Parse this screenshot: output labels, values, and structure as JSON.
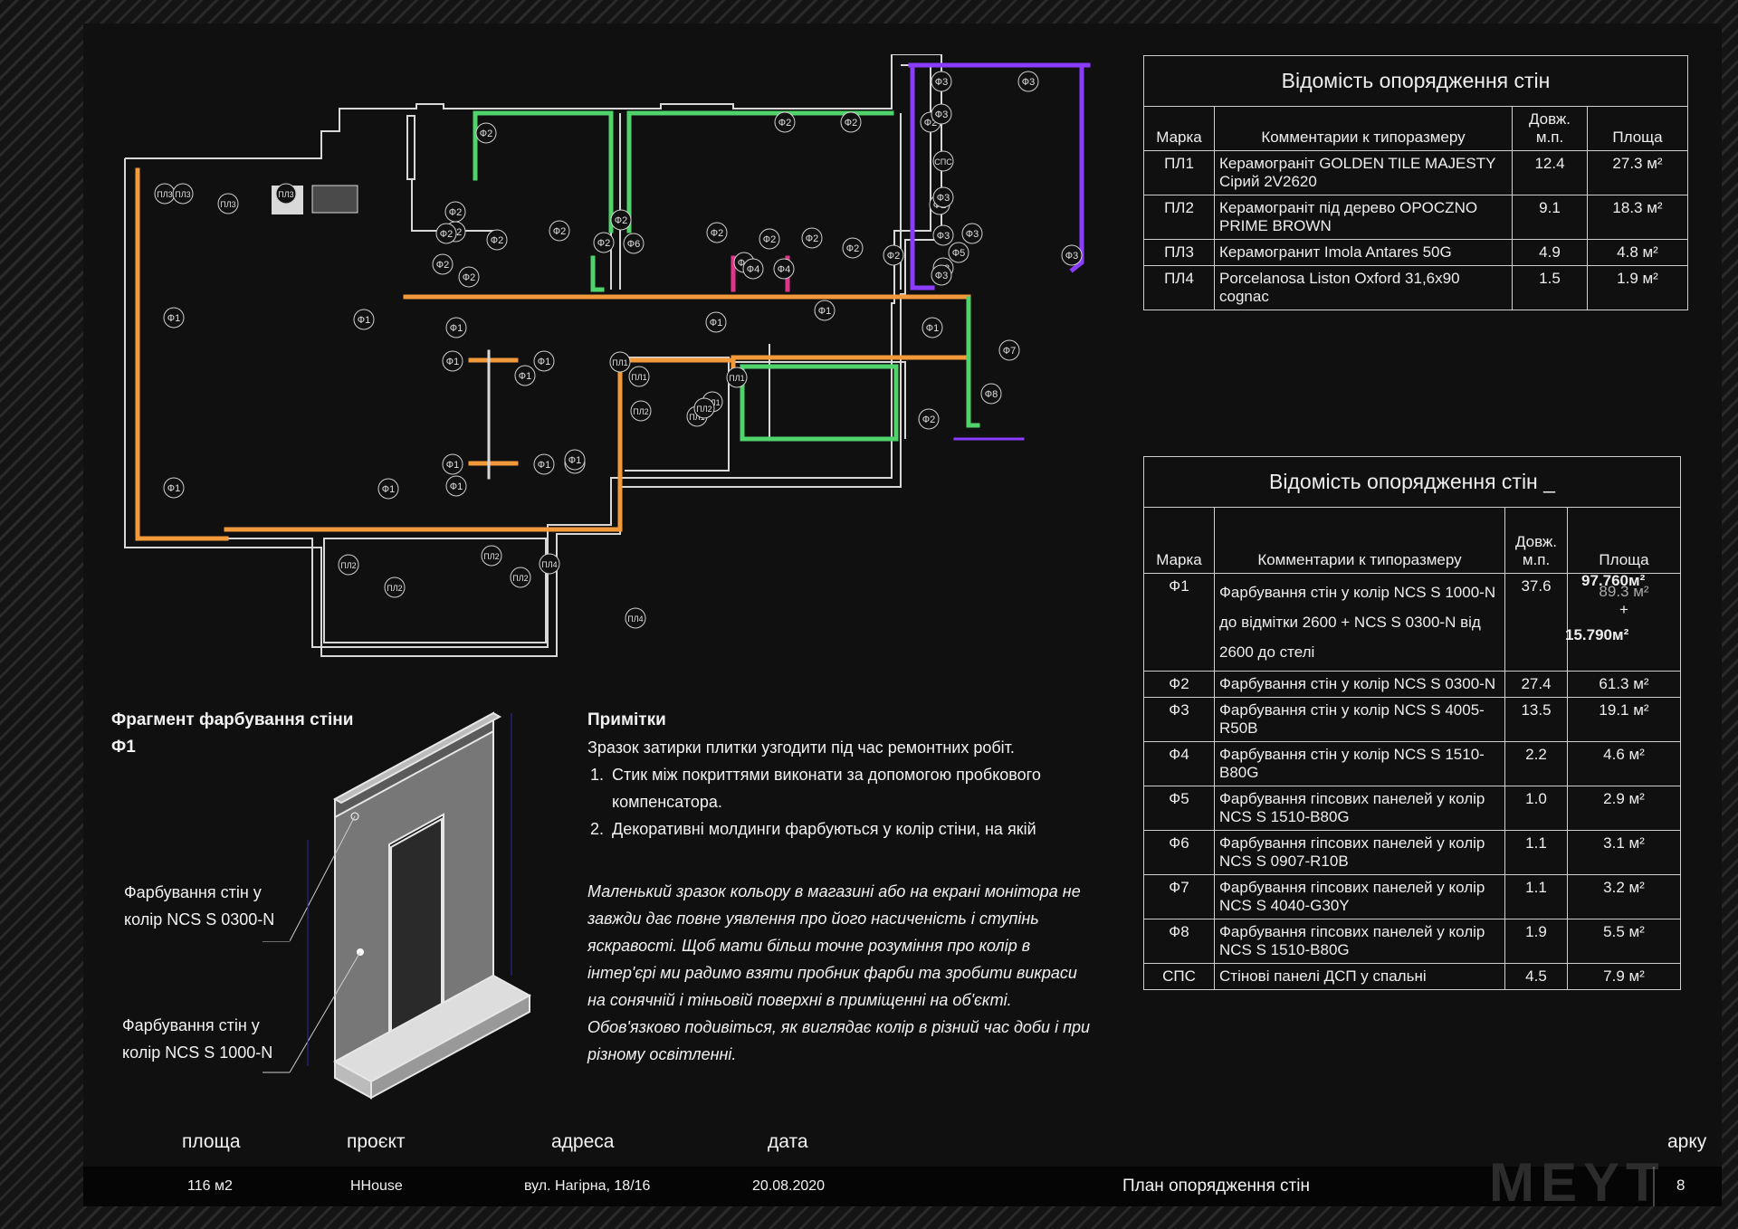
{
  "table1": {
    "title": "Відомість опорядження стін",
    "headers": [
      "Марка",
      "Комментарии к типоразмеру",
      "Довж. м.п.",
      "Площа"
    ],
    "rows": [
      {
        "mark": "ПЛ1",
        "comment": "Керамограніт GOLDEN TILE MAJESTY Сірий 2V2620",
        "length": "12.4",
        "area": "27.3 м²"
      },
      {
        "mark": "ПЛ2",
        "comment": "Керамограніт під дерево OPOCZNO PRIME BROWN",
        "length": "9.1",
        "area": "18.3 м²"
      },
      {
        "mark": "ПЛ3",
        "comment": "Керамогранит Imola Antares 50G",
        "length": "4.9",
        "area": "4.8 м²"
      },
      {
        "mark": "ПЛ4",
        "comment": "Porcelanosa Liston Oxford 31,6x90 cognac",
        "length": "1.5",
        "area": "1.9 м²"
      }
    ]
  },
  "table2": {
    "title": "Відомість опорядження стін _",
    "headers": [
      "Марка",
      "Комментарии к типоразмеру",
      "Довж. м.п.",
      "Площа"
    ],
    "rows": [
      {
        "mark": "Ф1",
        "comment": "Фарбування стін у колір NCS S 1000-N до відмітки 2600 + NCS S 0300-N від 2600 до стелі",
        "length": "37.6",
        "area": "89.3 м²",
        "area_extra_1": "97.760м²",
        "area_extra_plus": "+",
        "area_extra_2": "15.790м²"
      },
      {
        "mark": "Ф2",
        "comment": "Фарбування стін у колір NCS S 0300-N",
        "length": "27.4",
        "area": "61.3 м²"
      },
      {
        "mark": "Ф3",
        "comment": "Фарбування стін у колір NCS S 4005-R50B",
        "length": "13.5",
        "area": "19.1 м²"
      },
      {
        "mark": "Ф4",
        "comment": "Фарбування стін у колір NCS S 1510-B80G",
        "length": "2.2",
        "area": "4.6 м²"
      },
      {
        "mark": "Ф5",
        "comment": "Фарбування гіпсових панелей у колір NCS S 1510-B80G",
        "length": "1.0",
        "area": "2.9 м²"
      },
      {
        "mark": "Ф6",
        "comment": "Фарбування гіпсових панелей у колір NCS S 0907-R10B",
        "length": "1.1",
        "area": "3.1 м²"
      },
      {
        "mark": "Ф7",
        "comment": "Фарбування гіпсових панелей у колір NCS S 4040-G30Y",
        "length": "1.1",
        "area": "3.2 м²"
      },
      {
        "mark": "Ф8",
        "comment": "Фарбування гіпсових панелей у колір NCS S 1510-B80G",
        "length": "1.9",
        "area": "5.5 м²"
      },
      {
        "mark": "СПС",
        "comment": "Стінові панелі ДСП у спальні",
        "length": "4.5",
        "area": "7.9 м²"
      }
    ]
  },
  "plan": {
    "tags": [
      "ПЛ3",
      "ПЛ3",
      "ПЛ3",
      "ПЛ3",
      "Ф1",
      "Ф1",
      "Ф1",
      "Ф1",
      "Ф1",
      "Ф1",
      "Ф1",
      "Ф1",
      "Ф1",
      "Ф1",
      "Ф1",
      "Ф1",
      "Ф1",
      "Ф1",
      "Ф1",
      "Ф1",
      "Ф2",
      "Ф2",
      "Ф2",
      "Ф2",
      "Ф2",
      "Ф2",
      "Ф2",
      "Ф2",
      "Ф2",
      "Ф2",
      "Ф2",
      "Ф2",
      "Ф2",
      "Ф2",
      "Ф2",
      "Ф2",
      "Ф2",
      "Ф2",
      "Ф2",
      "Ф2",
      "Ф3",
      "Ф3",
      "Ф3",
      "Ф3",
      "Ф3",
      "Ф3",
      "Ф3",
      "Ф3",
      "Ф3",
      "Ф3",
      "Ф3",
      "Ф3",
      "СПС",
      "Ф4",
      "Ф4",
      "Ф4",
      "Ф5",
      "Ф6",
      "Ф7",
      "Ф8",
      "ПЛ1",
      "ПЛ1",
      "ПЛ1",
      "ПЛ1",
      "ПЛ1",
      "ПЛ2",
      "ПЛ2",
      "ПЛ2",
      "ПЛ2",
      "ПЛ2",
      "ПЛ2",
      "ПЛ4",
      "ПЛ4"
    ],
    "colors": {
      "orange": "#f29a3a",
      "green": "#4fd36a",
      "purple": "#8a3cff",
      "pink": "#e0368a",
      "wall": "#d8d8d8"
    }
  },
  "fragment": {
    "title_line1": "Фрагмент фарбування стіни",
    "title_line2": "Ф1",
    "label1_line1": "Фарбування стін у",
    "label1_line2": "колір NCS S 0300-N",
    "label2_line1": "Фарбування стін у",
    "label2_line2": "колір NCS S 1000-N"
  },
  "notes": {
    "title": "Примітки",
    "intro": "Зразок затирки плитки узгодити під час ремонтних робіт.",
    "items": [
      "Стик між покриттями виконати за допомогою пробкового компенсатора.",
      "Декоративні молдинги фарбуються у колір стіни, на якій"
    ],
    "italic": "Маленький зразок кольору в магазині або на екрані монітора не завжди дає повне уявлення про його насиченість і ступінь яскравості. Щоб мати більш точне розуміння про колір в інтер'єрі  ми радимо взяти пробник фарби та зробити викраси на сонячній і тіньовій поверхні в приміщенні на об'єкті. Обов'язково подивіться, як виглядає колір в різний час доби і при різному освітленні."
  },
  "footer": {
    "area_label": "площа",
    "area_value": "116 м2",
    "project_label": "проєкт",
    "project_value": "HHouse",
    "address_label": "адреса",
    "address_value": "вул. Нагірна, 18/16",
    "date_label": "дата",
    "date_value": "20.08.2020",
    "sheet_title": "План опорядження стін",
    "sheet_label": "арку",
    "sheet_number": "8",
    "logo": "MEYT"
  }
}
